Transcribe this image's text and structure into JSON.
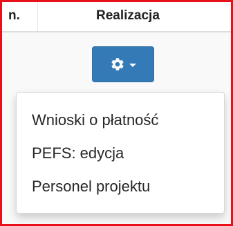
{
  "table": {
    "columns": [
      {
        "label": "n."
      },
      {
        "label": "Realizacja"
      }
    ]
  },
  "actions": {
    "button_icon": "gear-icon",
    "caret_icon": "caret-down-icon",
    "button_color": "#337ab7"
  },
  "dropdown": {
    "items": [
      {
        "label": "Wnioski o płatność"
      },
      {
        "label": "PEFS: edycja"
      },
      {
        "label": "Personel projektu"
      }
    ]
  },
  "highlight_color": "#e8111a"
}
